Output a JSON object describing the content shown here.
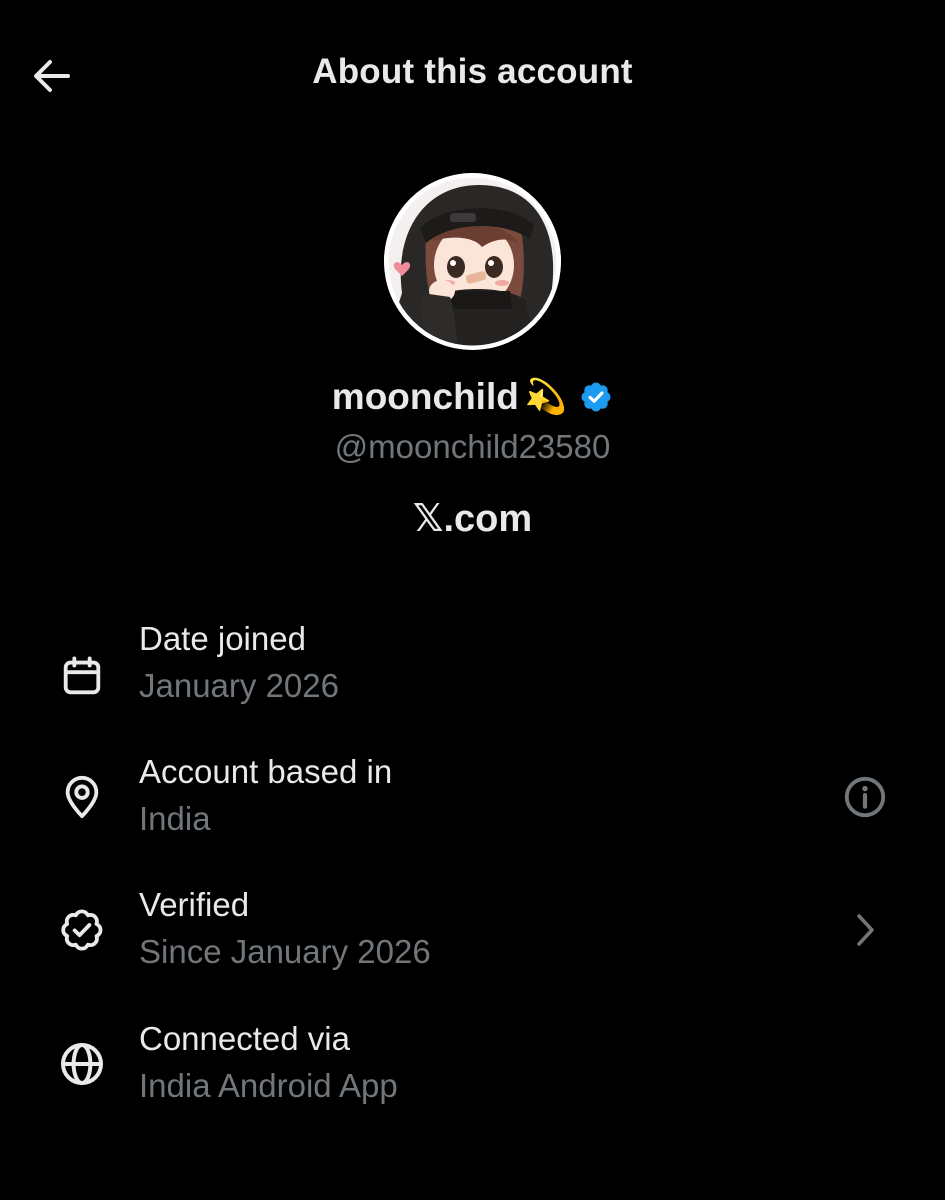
{
  "header": {
    "title": "About this account",
    "back_icon": "arrow-left-icon"
  },
  "profile": {
    "display_name": "moonchild",
    "name_emoji": "💫",
    "verified_icon": "verified-badge-icon",
    "verified_color": "#1d9bf0",
    "handle": "@moonchild23580",
    "platform": "𝕏.com"
  },
  "details": [
    {
      "icon": "calendar-icon",
      "label": "Date joined",
      "value": "January 2026"
    },
    {
      "icon": "location-pin-icon",
      "label": "Account based in",
      "value": "India",
      "trailing_icon": "info-icon"
    },
    {
      "icon": "verified-outline-icon",
      "label": "Verified",
      "value": "Since January 2026",
      "trailing_icon": "chevron-right-icon"
    },
    {
      "icon": "globe-icon",
      "label": "Connected via",
      "value": "India Android App"
    }
  ],
  "colors": {
    "background": "#000000",
    "primary_text": "#e7e9ea",
    "secondary_text": "#71767b",
    "accent": "#1d9bf0"
  }
}
